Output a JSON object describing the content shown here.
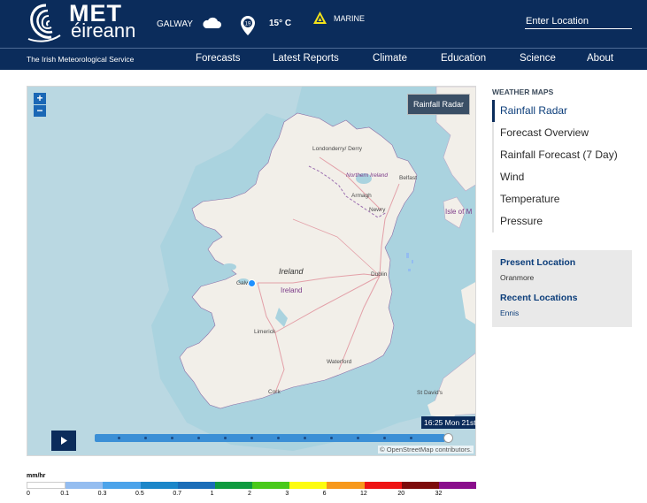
{
  "header": {
    "brand_top": "MET",
    "brand_bottom": "éireann",
    "tagline": "The Irish Meteorological Service",
    "location": "GALWAY",
    "forecast_badge": "19",
    "temperature": "15° C",
    "marine_label": "MARINE",
    "search_placeholder": "Enter Location"
  },
  "nav": [
    "Forecasts",
    "Latest Reports",
    "Climate",
    "Education",
    "Science",
    "About"
  ],
  "map": {
    "layer_badge": "Rainfall Radar",
    "zoom_in": "+",
    "zoom_out": "−",
    "time_label": "16:25 Mon 21st",
    "timeline_progress": 1.0,
    "attribution": "© OpenStreetMap contributors.",
    "labels": {
      "ireland_en": "Ireland",
      "ireland_ga": "Ireland",
      "galway": "Galw",
      "dublin": "Dublin",
      "limerick": "Limerick",
      "waterford": "Waterford",
      "cork": "Cork",
      "belfast": "Belfast",
      "northern_ireland": "Northern Ireland",
      "derry": "Londonderry/ Derry",
      "armagh": "Armagh",
      "newry": "Newry",
      "isle": "Isle of M",
      "st_davids": "St David's"
    }
  },
  "legend": {
    "unit": "mm/hr",
    "values": [
      "0",
      "0.1",
      "0.3",
      "0.5",
      "0.7",
      "1",
      "2",
      "3",
      "6",
      "12",
      "20",
      "32"
    ],
    "colors": [
      "#ffffff",
      "#94bdf0",
      "#4ba3ea",
      "#1b86c9",
      "#1a6db8",
      "#0e9a3f",
      "#49c91a",
      "#fdfc0f",
      "#f7981b",
      "#ee1313",
      "#7c0b0b",
      "#8a0d8c"
    ]
  },
  "sidebar": {
    "heading": "WEATHER MAPS",
    "items": [
      "Rainfall Radar",
      "Forecast Overview",
      "Rainfall Forecast (7 Day)",
      "Wind",
      "Temperature",
      "Pressure"
    ],
    "active_index": 0,
    "present_location_heading": "Present Location",
    "present_location": "Oranmore",
    "recent_locations_heading": "Recent Locations",
    "recent_locations": [
      "Ennis"
    ]
  }
}
